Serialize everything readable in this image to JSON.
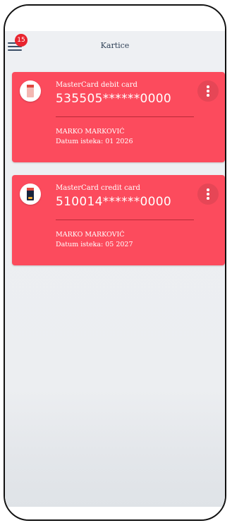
{
  "header": {
    "title": "Kartice",
    "notification_count": "15",
    "menu_icon": "hamburger-menu-icon"
  },
  "colors": {
    "card_background": "#fc4b5d",
    "badge": "#e8242e",
    "title_text": "#2f4157",
    "app_background": "#eef0f3"
  },
  "cards": [
    {
      "type": "MasterCard debit card",
      "number": "535505******0000",
      "holder": "MARKO MARKOVIĆ",
      "expiry": "Datum isteka: 01 2026",
      "thumbnail_icon": "debit-card-icon",
      "menu_icon": "more-vertical-icon"
    },
    {
      "type": "MasterCard credit card",
      "number": "510014******0000",
      "holder": "MARKO MARKOVIĆ",
      "expiry": "Datum isteka: 05 2027",
      "thumbnail_icon": "credit-card-icon",
      "menu_icon": "more-vertical-icon"
    }
  ]
}
